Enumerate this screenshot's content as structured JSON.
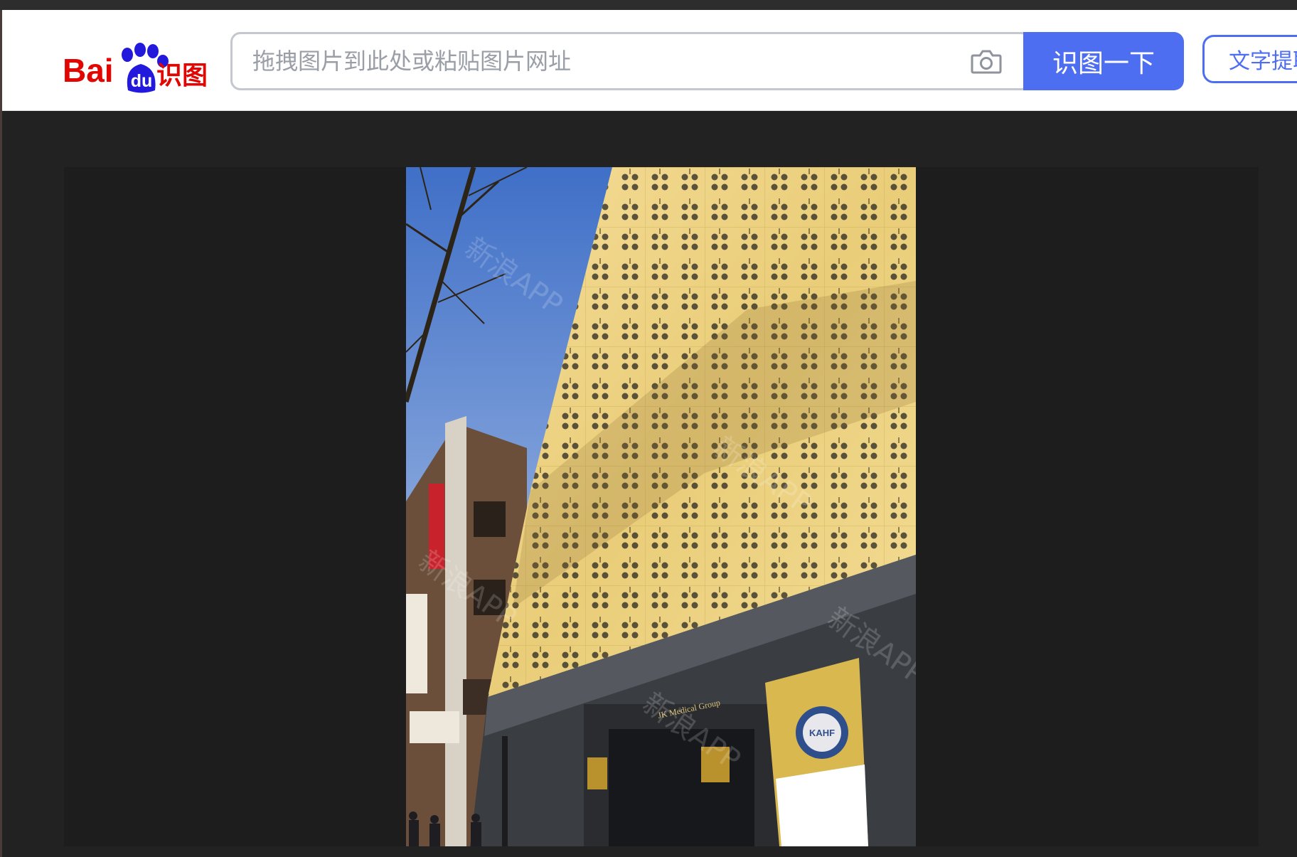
{
  "header": {
    "logo": {
      "text": "Bai",
      "paw": "du",
      "product": "识图"
    },
    "search": {
      "placeholder": "拖拽图片到此处或粘贴图片网址",
      "value": ""
    },
    "camera_icon": "camera-icon",
    "search_button_label": "识图一下",
    "ocr_button_label": "文字提取"
  },
  "viewer": {
    "photo_signage": {
      "building_sign": "JK Medical Group",
      "poster_badge": "KAHF"
    },
    "watermark": "新浪APP"
  },
  "colors": {
    "accent": "#4e6ef2",
    "logo_red": "#e10601",
    "logo_blue": "#2319dc",
    "background": "#222222"
  }
}
